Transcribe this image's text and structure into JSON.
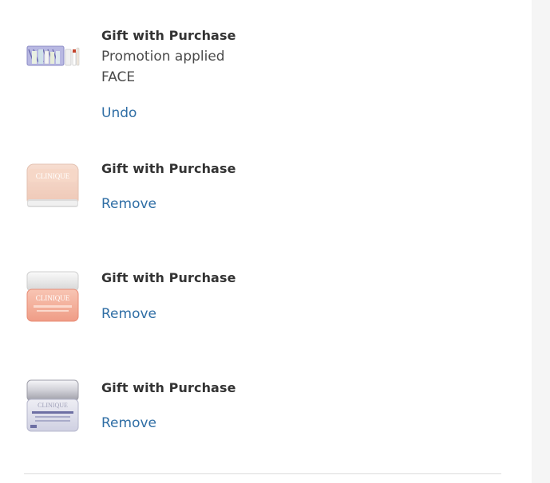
{
  "gifts": [
    {
      "title": "Gift with Purchase",
      "status": "Promotion applied",
      "category": "FACE",
      "action": "Undo",
      "thumb": "gift-set-icon"
    },
    {
      "title": "Gift with Purchase",
      "action": "Remove",
      "thumb": "peach-cream-jar-icon"
    },
    {
      "title": "Gift with Purchase",
      "action": "Remove",
      "thumb": "coral-cream-jar-icon"
    },
    {
      "title": "Gift with Purchase",
      "action": "Remove",
      "thumb": "silver-cream-jar-icon"
    }
  ],
  "jar_label_brand": "CLINIQUE",
  "colors": {
    "link": "#2f6ea5",
    "text": "#333333",
    "side_panel": "#f5f5f5",
    "divider": "#dcdcdc"
  }
}
